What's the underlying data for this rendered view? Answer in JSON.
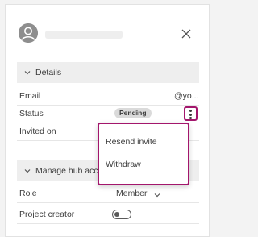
{
  "header": {
    "close_icon": "close-icon",
    "avatar_icon": "person-icon"
  },
  "details": {
    "title": "Details",
    "email_label": "Email",
    "email_value": "@yo...",
    "status_label": "Status",
    "status_value": "Pending",
    "invited_label": "Invited on"
  },
  "actions_menu": {
    "items": [
      "Resend invite",
      "Withdraw"
    ]
  },
  "hub_access": {
    "title": "Manage hub acc",
    "role_label": "Role",
    "role_value": "Member",
    "project_creator_label": "Project creator",
    "project_creator_enabled": false
  },
  "colors": {
    "accent": "#a3166c",
    "section_bg": "#eeeeee",
    "badge_bg": "#dadada"
  }
}
